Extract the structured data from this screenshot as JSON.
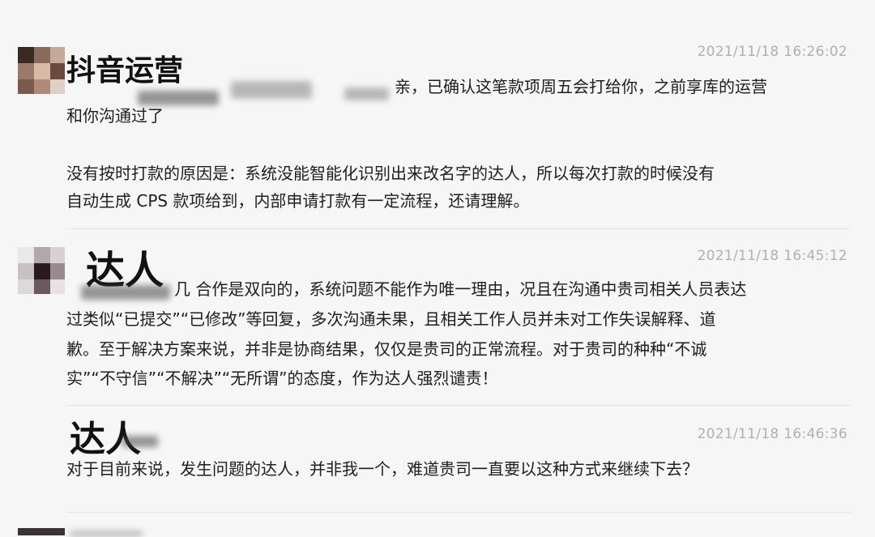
{
  "messages": [
    {
      "sender": "抖音运营",
      "timestamp": "2021/11/18 16:26:02",
      "lines": [
        "亲，已确认这笔款项周五会打给你，之前享库的运营",
        "和你沟通过了",
        "没有按时打款的原因是：系统没能智能化识别出来改名字的达人，所以每次打款的时候没有",
        "自动生成 CPS 款项给到，内部申请打款有一定流程，还请理解。"
      ]
    },
    {
      "sender": "达人",
      "timestamp": "2021/11/18 16:45:12",
      "lines": [
        "几 合作是双向的，系统问题不能作为唯一理由，况且在沟通中贵司相关人员表达",
        "过类似“已提交”“已修改”等回复，多次沟通未果，且相关工作人员并未对工作失误解释、道",
        "歉。至于解决方案来说，并非是协商结果，仅仅是贵司的正常流程。对于贵司的种种“不诚",
        "实”“不守信”“不解决”“无所谓”的态度，作为达人强烈谴责！"
      ]
    },
    {
      "sender": "达人",
      "timestamp": "2021/11/18 16:46:36",
      "lines": [
        "对于目前来说，发生问题的达人，并非我一个，难道贵司一直要以这种方式来继续下去？"
      ]
    }
  ]
}
